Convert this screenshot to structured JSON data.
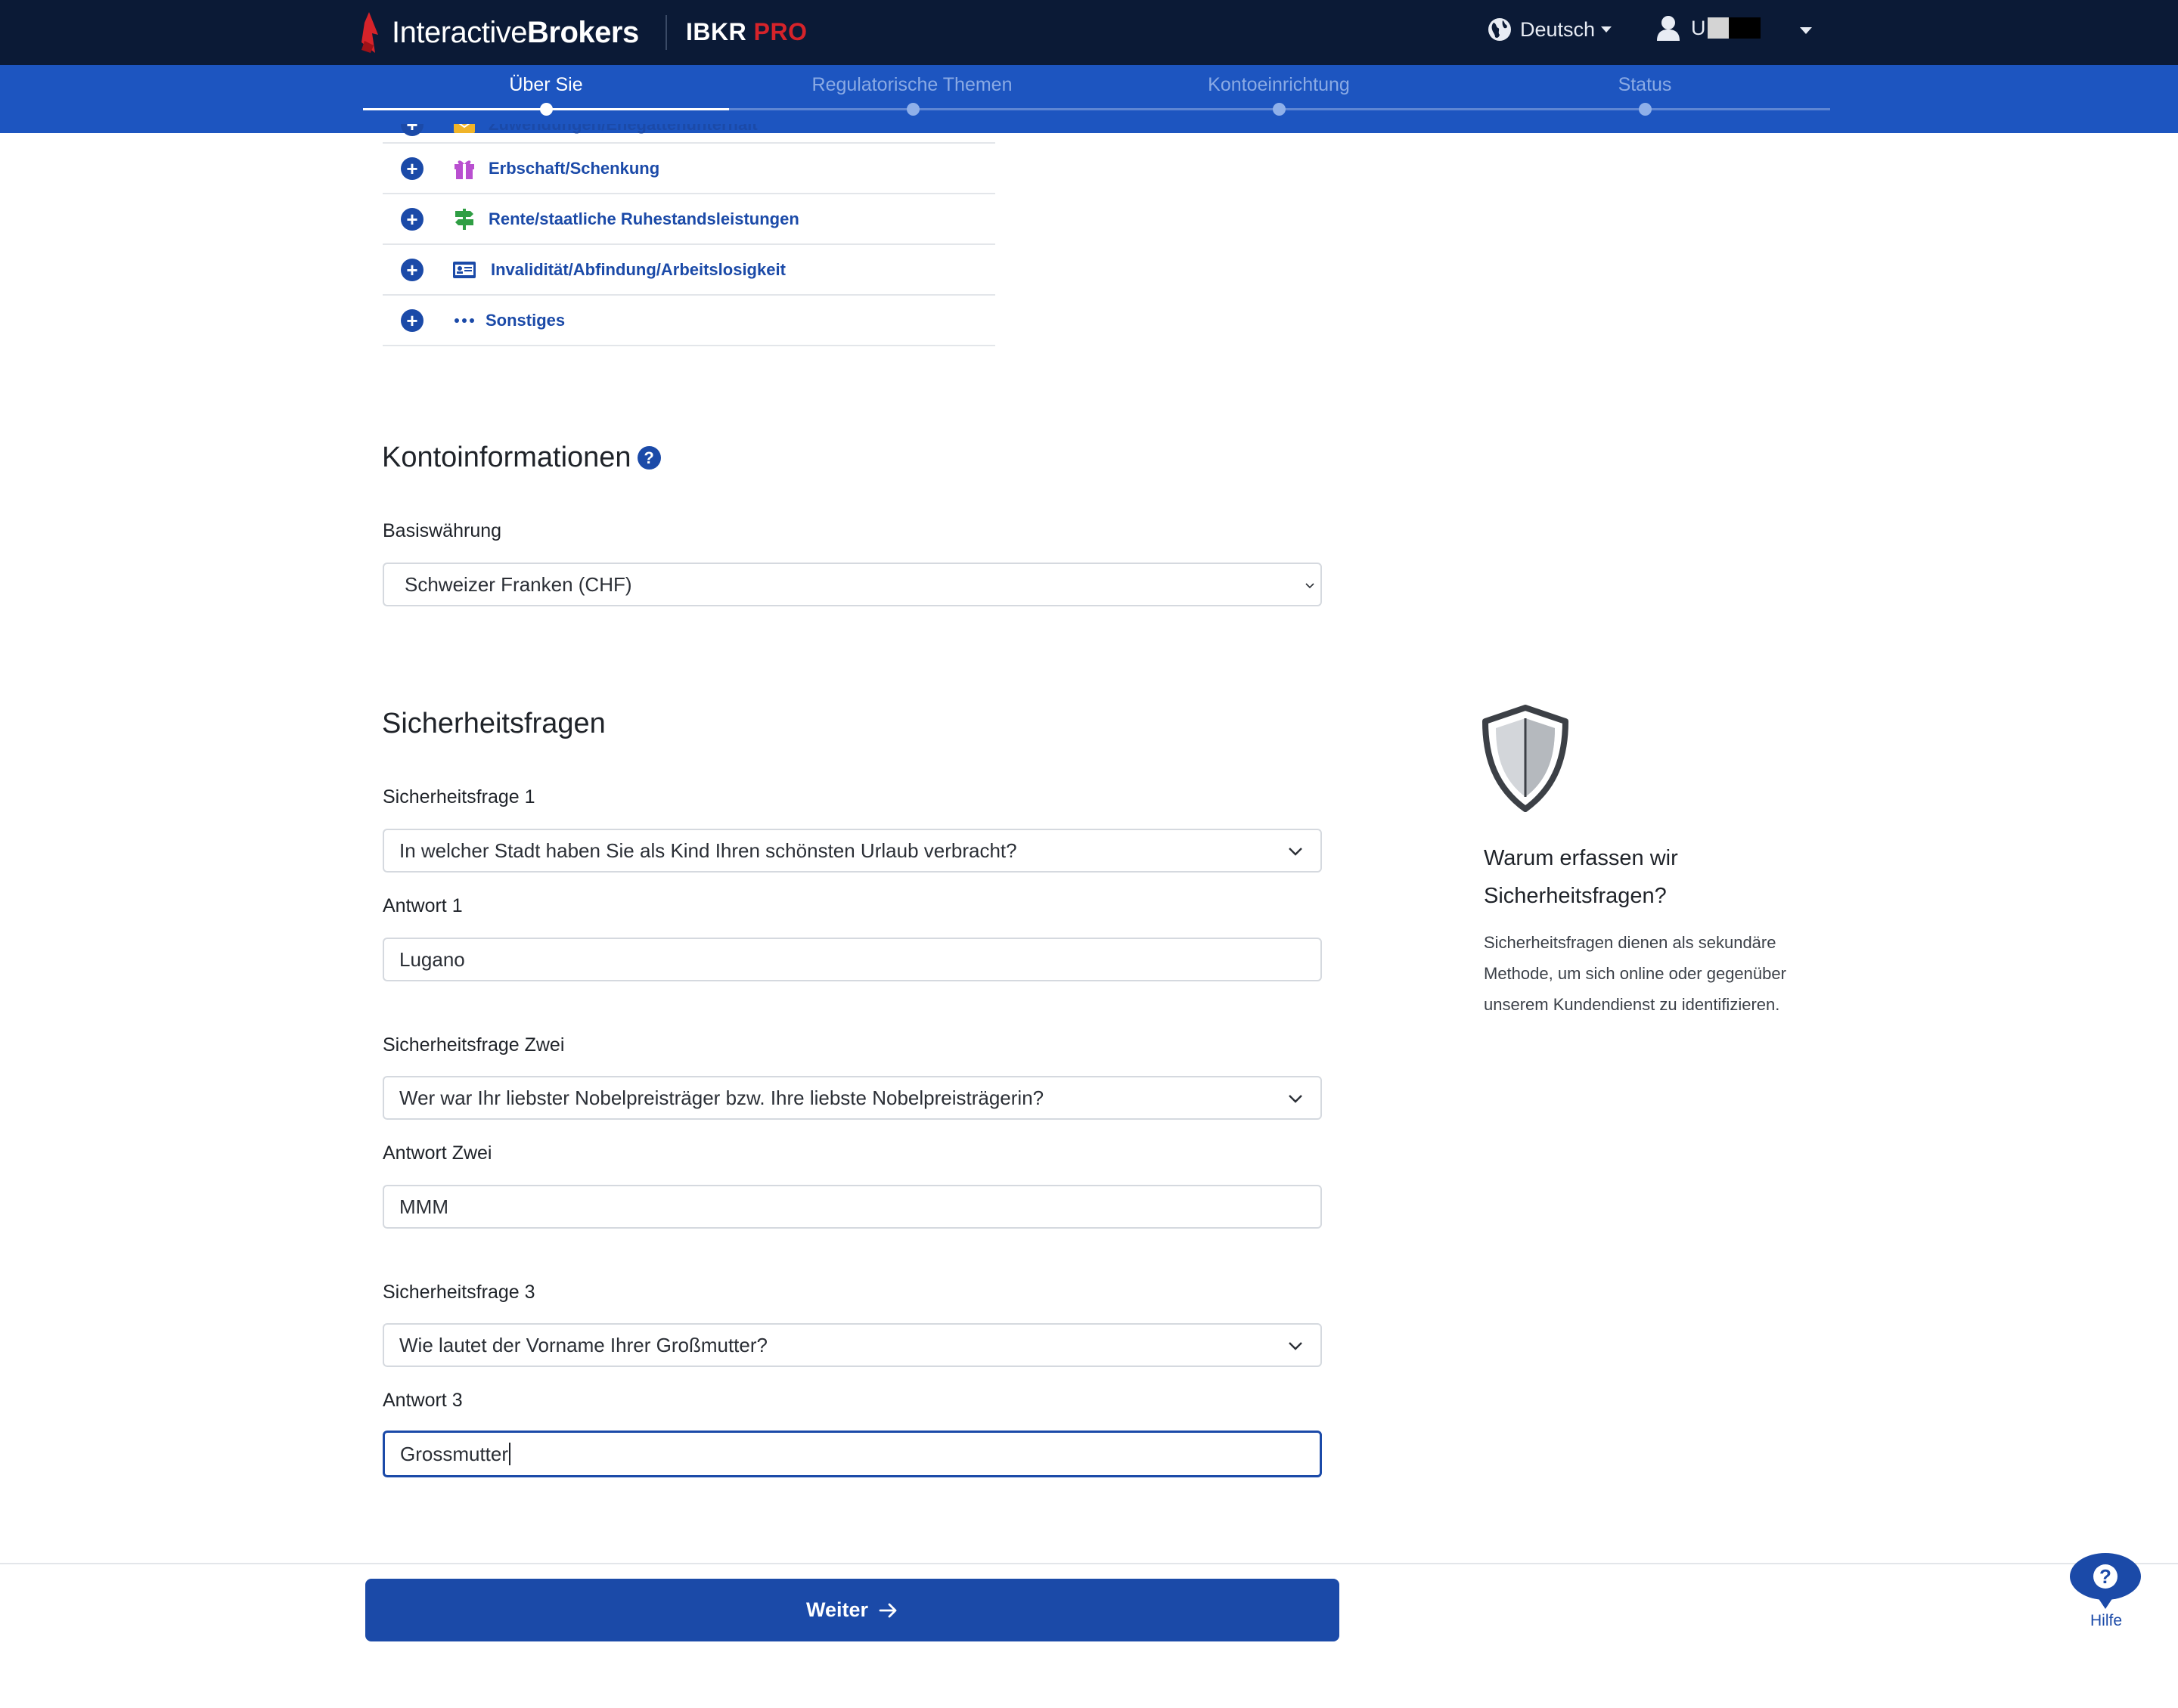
{
  "header": {
    "brand_light": "Interactive",
    "brand_bold": "Brokers",
    "product": "IBKR",
    "product_suffix": "PRO",
    "language": "Deutsch",
    "user_initial": "U"
  },
  "steps": [
    {
      "label": "Über Sie",
      "active": true
    },
    {
      "label": "Regulatorische Themen",
      "active": false
    },
    {
      "label": "Kontoeinrichtung",
      "active": false
    },
    {
      "label": "Status",
      "active": false
    }
  ],
  "income_sources": [
    {
      "label": "Zuwendungen/Ehegattenunterhalt",
      "icon": "envelope-icon"
    },
    {
      "label": "Erbschaft/Schenkung",
      "icon": "gift-icon"
    },
    {
      "label": "Rente/staatliche Ruhestandsleistungen",
      "icon": "signpost-icon"
    },
    {
      "label": "Invalidität/Abfindung/Arbeitslosigkeit",
      "icon": "id-card-icon"
    },
    {
      "label": "Sonstiges",
      "icon": "more-dots-icon"
    }
  ],
  "account_info": {
    "title": "Kontoinformationen",
    "help_glyph": "?",
    "base_currency_label": "Basiswährung",
    "base_currency_value": "Schweizer Franken (CHF)"
  },
  "security": {
    "title": "Sicherheitsfragen",
    "q1_label": "Sicherheitsfrage 1",
    "q1_value": "In welcher Stadt haben Sie als Kind Ihren schönsten Urlaub verbracht?",
    "a1_label": "Antwort 1",
    "a1_value": "Lugano",
    "q2_label": "Sicherheitsfrage Zwei",
    "q2_value": "Wer war Ihr liebster Nobelpreisträger bzw. Ihre liebste Nobelpreisträgerin?",
    "a2_label": "Antwort Zwei",
    "a2_value": "MMM",
    "q3_label": "Sicherheitsfrage 3",
    "q3_value": "Wie lautet der Vorname Ihrer Großmutter?",
    "a3_label": "Antwort 3",
    "a3_value": "Grossmutter"
  },
  "side_info": {
    "title": "Warum erfassen wir Sicherheitsfragen?",
    "text": "Sicherheitsfragen dienen als sekundäre Methode, um sich online oder gegenüber unserem Kundendienst zu identifizieren."
  },
  "footer": {
    "next_label": "Weiter",
    "help_label": "Hilfe",
    "help_glyph": "?"
  },
  "colors": {
    "topbar": "#0b1a36",
    "stepsbar": "#1d55c0",
    "accent": "#1b4aa8",
    "brand_red": "#d6232a"
  }
}
